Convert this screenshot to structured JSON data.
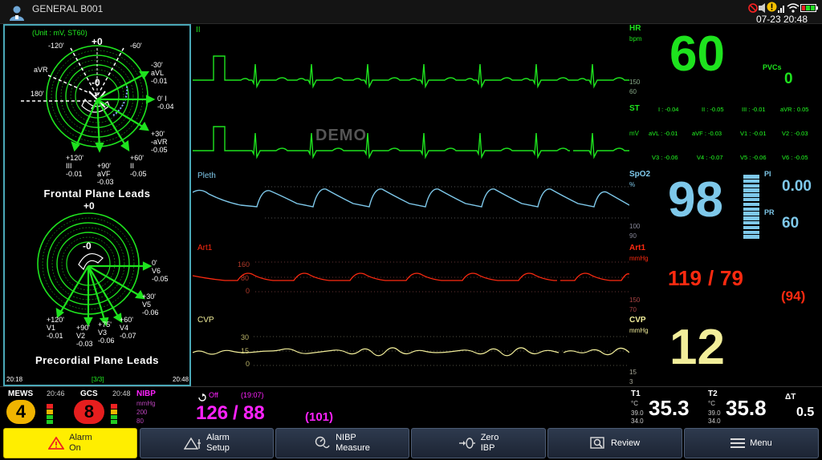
{
  "header": {
    "patient_title": "GENERAL B001",
    "datetime": "07-23 20:48"
  },
  "st_panel": {
    "unit": "(Unit : mV, ST60)",
    "frontal": {
      "title": "Frontal Plane Leads",
      "top": "+0",
      "center": "-0",
      "a_m120": "-120'",
      "a_m60": "-60'",
      "avr": "aVR",
      "a_180": "180'",
      "avl": "-30'\naVL\n-0.01",
      "lead_i": "0' I\n-0.04",
      "neg_avr": "+30'\n-aVR\n-0.05",
      "lead_iii": "+120'\nIII\n-0.01",
      "avf": "+90'\naVF\n-0.03",
      "lead_ii": "+60'\nII\n-0.05"
    },
    "precordial": {
      "title": "Precordial Plane Leads",
      "top": "+0",
      "center": "-0",
      "v6": "0'\nV6\n-0.05",
      "v5": "+30'\nV5\n-0.06",
      "v4": "+60'\nV4\n-0.07",
      "v3": "+75'\nV3\n-0.06",
      "v2": "+90'\nV2\n-0.03",
      "v1": "+120'\nV1\n-0.01"
    },
    "footer": {
      "left": "20:18",
      "page": "[3/3]",
      "right": "20:48"
    }
  },
  "waves": {
    "ecg1_label": "II",
    "demo": "DEMO",
    "pleth_label": "Pleth",
    "art_label": "Art1",
    "art_scale": [
      "160",
      "80",
      "0"
    ],
    "cvp_label": "CVP",
    "cvp_scale": [
      "30",
      "15",
      "0"
    ]
  },
  "params": {
    "hr": {
      "label": "HR",
      "unit": "bpm",
      "value": "60",
      "upper": "150",
      "lower": "60"
    },
    "pvcs": {
      "label": "PVCs",
      "value": "0"
    },
    "st": {
      "label": "ST",
      "unit": "mV",
      "row1": [
        "I : -0.04",
        "II : -0.05",
        "III : -0.01",
        "aVR : 0.05"
      ],
      "row2": [
        "aVL : -0.01",
        "aVF : -0.03",
        "V1 : -0.01",
        "V2 : -0.03"
      ],
      "row3": [
        "V3 : -0.06",
        "V4 : -0.07",
        "V5 : -0.06",
        "V6 : -0.05"
      ]
    },
    "spo2": {
      "label": "SpO2",
      "unit": "%",
      "value": "98",
      "upper": "100",
      "lower": "90",
      "pi_label": "PI",
      "pi_value": "0.00",
      "pr_label": "PR",
      "pr_value": "60",
      "bar_level": 1.0
    },
    "art": {
      "label": "Art1",
      "unit": "mmHg",
      "sys": "119",
      "sep": "/",
      "dia": "79",
      "mean": "(94)",
      "upper": "150",
      "lower": "70"
    },
    "cvp": {
      "label": "CVP",
      "unit": "mmHg",
      "value": "12",
      "upper": "15",
      "lower": "3"
    }
  },
  "bottom": {
    "mews": {
      "label": "MEWS",
      "time": "20:46",
      "value": "4"
    },
    "gcs": {
      "label": "GCS",
      "time": "20:48",
      "value": "8"
    },
    "nibp": {
      "label": "NIBP",
      "unit": "mmHg",
      "upper": "200",
      "lower": "80",
      "status": "Off",
      "time": "(19:07)",
      "sys": "126",
      "sep": "/",
      "dia": "88",
      "mean": "(101)"
    },
    "t1": {
      "label": "T1",
      "unit": "°C",
      "upper": "39.0",
      "lower": "34.0",
      "value": "35.3"
    },
    "t2": {
      "label": "T2",
      "unit": "°C",
      "upper": "39.0",
      "lower": "34.0",
      "value": "35.8"
    },
    "dt": {
      "label": "ΔT",
      "value": "0.5"
    }
  },
  "buttons": {
    "alarm_on": "Alarm\nOn",
    "alarm_setup": "Alarm\nSetup",
    "nibp_measure": "NIBP\nMeasure",
    "zero_ibp": "Zero\nIBP",
    "review": "Review",
    "menu": "Menu"
  },
  "colors": {
    "ecg": "#1ee31e",
    "pleth": "#7ec8ea",
    "art": "#ff2a10",
    "cvp": "#f2ee9a",
    "nibp": "#ff22ff",
    "panel_border": "#4aa8b8"
  }
}
